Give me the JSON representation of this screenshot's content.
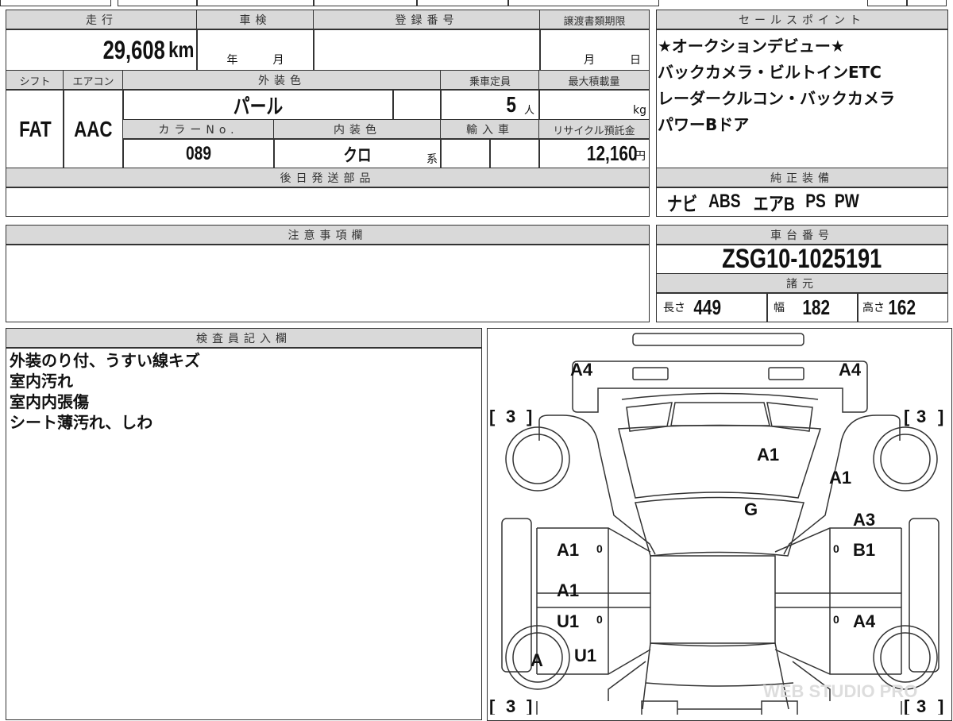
{
  "top_table": {
    "mileage": {
      "label": "走行",
      "value": "29,608",
      "unit": "km"
    },
    "shaken": {
      "label": "車検",
      "year_unit": "年",
      "month_unit": "月"
    },
    "registration": {
      "label": "登録番号",
      "value": ""
    },
    "transfer_deadline": {
      "label": "譲渡書類期限",
      "month_unit": "月",
      "day_unit": "日"
    },
    "shift": {
      "label": "シフト",
      "value": "FAT"
    },
    "aircon": {
      "label": "エアコン",
      "value": "AAC"
    },
    "exterior_color": {
      "label": "外装色",
      "value": "パール"
    },
    "capacity": {
      "label": "乗車定員",
      "value": "5",
      "unit": "人"
    },
    "max_load": {
      "label": "最大積載量",
      "unit": "kg"
    },
    "color_no": {
      "label": "カラーNo.",
      "value": "089"
    },
    "interior_color": {
      "label": "内装色",
      "value": "クロ",
      "suffix": "系"
    },
    "import": {
      "label": "輸入車"
    },
    "recycle_fee": {
      "label": "リサイクル預託金",
      "value": "12,160",
      "unit": "円"
    },
    "later_parts": {
      "label": "後日発送部品",
      "value": ""
    }
  },
  "sales_points": {
    "label": "セールスポイント",
    "lines": [
      "★オークションデビュー★",
      "バックカメラ・ビルトインETC",
      "レーダークルコン・バックカメラ",
      "パワーBドア"
    ]
  },
  "equipment": {
    "label": "純正装備",
    "items": [
      "ナビ",
      "ABS",
      "エアB",
      "PS",
      "PW"
    ]
  },
  "caution": {
    "label": "注意事項欄",
    "value": ""
  },
  "chassis": {
    "label": "車台番号",
    "value": "ZSG10-1025191"
  },
  "specs": {
    "label": "諸元",
    "length": {
      "label": "長さ",
      "value": "449"
    },
    "width": {
      "label": "幅",
      "value": "182"
    },
    "height": {
      "label": "高さ",
      "value": "162"
    }
  },
  "inspector": {
    "label": "検査員記入欄",
    "lines": [
      "外装のり付、うすい線キズ",
      "室内汚れ",
      "室内内張傷",
      "シート薄汚れ、しわ"
    ]
  },
  "diagram": {
    "marks": {
      "rear_left": "A4",
      "rear_right": "A4",
      "roof": "A1",
      "right_pillar": "A1",
      "windshield": "G",
      "right_rear_door_1": "A3",
      "right_rear_door_2": "B1",
      "left_rear_door": "A1",
      "left_front_door_1": "A1",
      "left_front_door_2": "U1",
      "right_front_door": "A4",
      "left_front_wheel": "A",
      "left_front_fender": "U1"
    },
    "tread": {
      "rl": "3",
      "rr": "3",
      "fl": "3",
      "fr": "3"
    },
    "door_zeros": [
      "0",
      "0",
      "0",
      "0"
    ],
    "watermark": "WEB STUDIO PRO"
  }
}
